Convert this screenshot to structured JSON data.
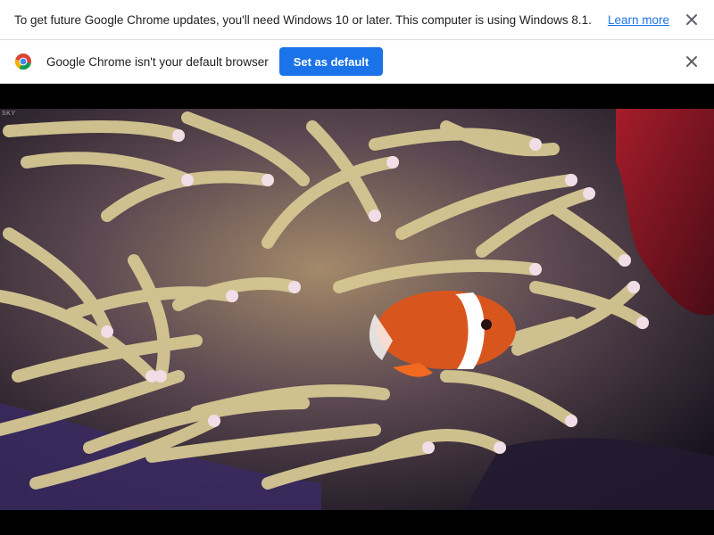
{
  "infobars": {
    "update": {
      "message": "To get future Google Chrome updates, you'll need Windows 10 or later. This computer is using Windows 8.1.",
      "learn_more_label": "Learn more",
      "close_icon": "close-icon"
    },
    "default_browser": {
      "logo_icon": "chrome-logo-icon",
      "message": "Google Chrome isn't your default browser",
      "button_label": "Set as default",
      "close_icon": "close-icon"
    }
  },
  "video": {
    "watermark": "SKY",
    "content": "clownfish-in-anemone"
  },
  "colors": {
    "accent": "#1a73e8",
    "infobar_bg": "#ffffff",
    "text": "#202124",
    "close_icon": "#5f6368",
    "letterbox": "#000000",
    "anemone": "#d8c89a",
    "anemone_tip": "#f2e0e8",
    "fish_orange": "#e2581f",
    "coral_red": "#8a1622"
  }
}
